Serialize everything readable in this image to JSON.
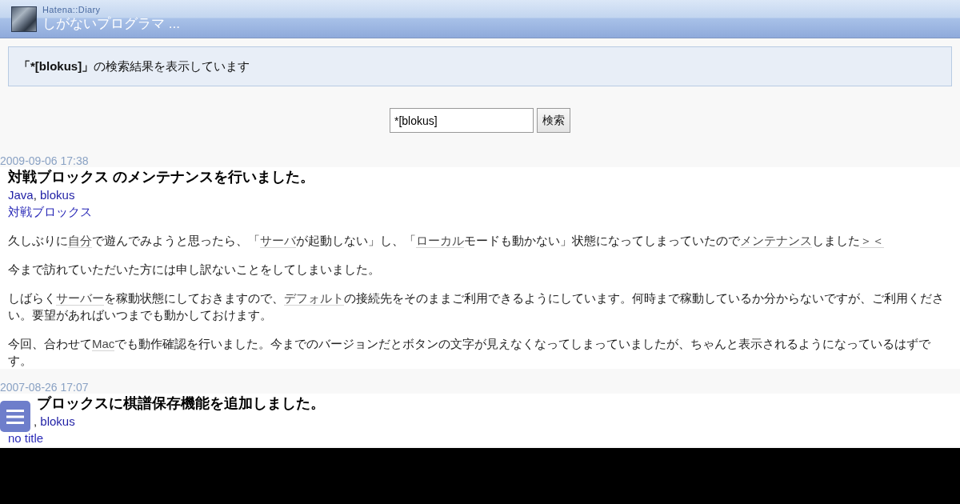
{
  "header": {
    "site": "Hatena::Diary",
    "title": "しがないプログラマ ..."
  },
  "notice": {
    "query": "「*[blokus]」",
    "text": "の検索結果を表示しています"
  },
  "search": {
    "value": "*[blokus]",
    "button": "検索"
  },
  "entries": [
    {
      "date": "2009-09-06 17:38",
      "covered_by_menu": false,
      "title": "対戦ブロックス のメンテナンスを行いました。",
      "categories": {
        "items": [
          "Java",
          "blokus"
        ],
        "separator": ", "
      },
      "section": "対戦ブロックス",
      "paragraphs": [
        [
          {
            "kind": "text",
            "text": "久しぶりに"
          },
          {
            "kind": "keyword",
            "text": "自分"
          },
          {
            "kind": "text",
            "text": "で遊んでみようと思ったら、「"
          },
          {
            "kind": "keyword",
            "text": "サーバ"
          },
          {
            "kind": "text",
            "text": "が起動しない」し、「"
          },
          {
            "kind": "keyword",
            "text": "ローカル"
          },
          {
            "kind": "text",
            "text": "モードも動かない」状態になってしまっていたので"
          },
          {
            "kind": "keyword",
            "text": "メンテナンス"
          },
          {
            "kind": "text",
            "text": "しました"
          },
          {
            "kind": "keyword",
            "text": "＞＜"
          }
        ],
        [
          {
            "kind": "text",
            "text": "今まで訪れていただいた方には申し訳ないことをしてしまいました。"
          }
        ],
        [
          {
            "kind": "text",
            "text": "しばらく"
          },
          {
            "kind": "keyword",
            "text": "サーバー"
          },
          {
            "kind": "text",
            "text": "を稼動状態にしておきますので、"
          },
          {
            "kind": "keyword",
            "text": "デフォルト"
          },
          {
            "kind": "text",
            "text": "の接続先をそのままご利用できるようにしています。何時まで稼動しているか分からないですが、ご利用ください。要望があればいつまでも動かしておけます。"
          }
        ],
        [
          {
            "kind": "text",
            "text": "今回、合わせて"
          },
          {
            "kind": "keyword",
            "text": "Mac"
          },
          {
            "kind": "text",
            "text": "でも動作確認を行いました。今までのバージョンだとボタンの文字が見えなくなってしまっていましたが、ちゃんと表示されるようになっているはずです。"
          }
        ]
      ]
    },
    {
      "date": "2007-08-26 17:07",
      "covered_by_menu": true,
      "title": "ブロックスに棋譜保存機能を追加しました。",
      "categories": {
        "items": [
          "blokus"
        ],
        "separator": ", "
      },
      "section": "no title"
    }
  ]
}
